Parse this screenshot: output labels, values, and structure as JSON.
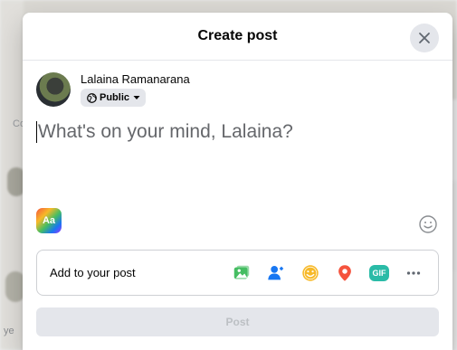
{
  "dialog": {
    "title": "Create post",
    "close_label": "Close"
  },
  "user": {
    "name": "Lalaina Ramanarana",
    "privacy": "Public"
  },
  "composer": {
    "placeholder": "What's on your mind, Lalaina?"
  },
  "text_background": {
    "label": "Aa"
  },
  "add_to_post": {
    "label": "Add to your post",
    "icons": [
      "photo-video-icon",
      "tag-people-icon",
      "feeling-icon",
      "check-in-icon",
      "gif-icon",
      "more-icon"
    ],
    "gif_label": "GIF"
  },
  "post_button": {
    "label": "Post"
  },
  "background": {
    "left_text": "ye",
    "c_text": "Co"
  },
  "colors": {
    "accent_blue": "#1877f2",
    "photo_green": "#45bd62",
    "feeling_yellow": "#f7b928",
    "checkin_red": "#f5533d",
    "gif_teal": "#2abba7",
    "disabled_bg": "#e4e6eb",
    "disabled_text": "#bcc0c4"
  }
}
